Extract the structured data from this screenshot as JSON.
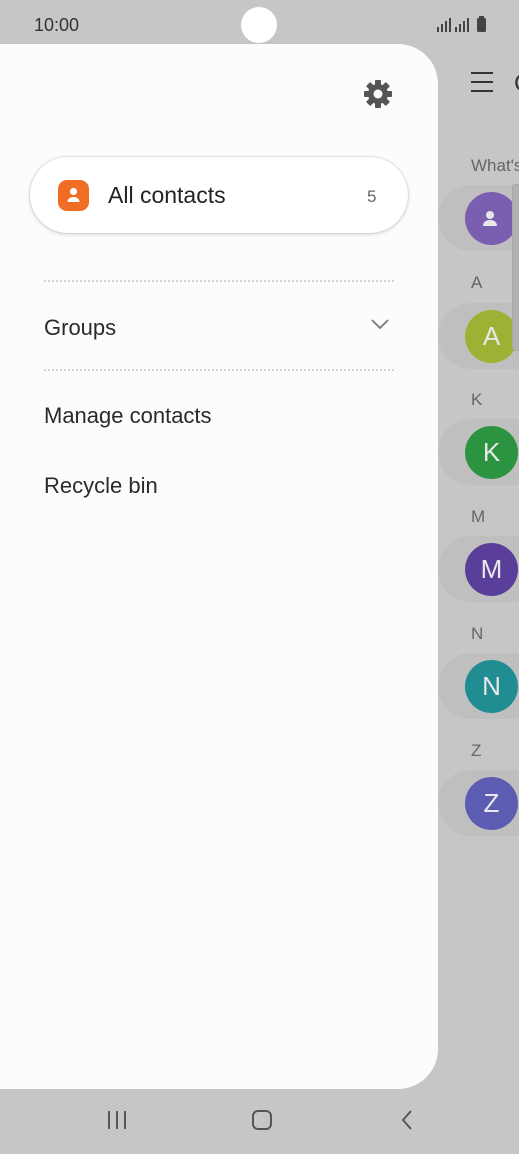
{
  "status_bar": {
    "time": "10:00"
  },
  "drawer": {
    "all_contacts": {
      "label": "All contacts",
      "count": "5"
    },
    "groups": {
      "label": "Groups"
    },
    "manage_contacts": {
      "label": "Manage contacts"
    },
    "recycle_bin": {
      "label": "Recycle bin"
    }
  },
  "background_list": {
    "title_fragment": "C",
    "whats_new_fragment": "What's",
    "sections": [
      {
        "letter": "A",
        "avatar": "A",
        "color": "#9fb135"
      },
      {
        "letter": "K",
        "avatar": "K",
        "color": "#2c9440"
      },
      {
        "letter": "M",
        "avatar": "M",
        "color": "#5a3f9a"
      },
      {
        "letter": "N",
        "avatar": "N",
        "color": "#1f8d92"
      },
      {
        "letter": "Z",
        "avatar": "Z",
        "color": "#5d5cb3"
      }
    ],
    "profile_avatar_color": "#7a5fb0"
  },
  "colors": {
    "accent": "#ef6e23"
  },
  "icons": {
    "settings": "gear-icon",
    "all_contacts": "contact-book-icon",
    "groups_expand": "chevron-down-icon",
    "menu": "hamburger-icon",
    "nav_recents": "recents-icon",
    "nav_home": "home-icon",
    "nav_back": "back-icon"
  }
}
